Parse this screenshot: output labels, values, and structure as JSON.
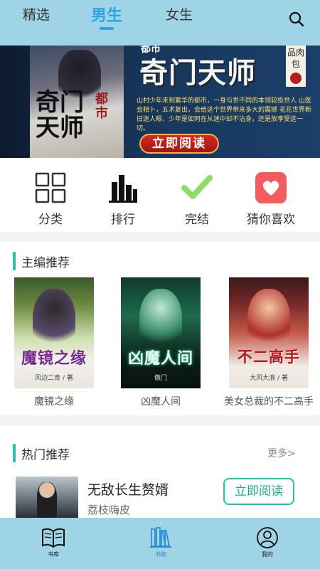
{
  "top_tabs": {
    "featured": "精选",
    "male": "男生",
    "female": "女生"
  },
  "banner": {
    "tag": "都市",
    "title": "奇门天师",
    "side_text": "品肉包",
    "cover_title": "奇门天师",
    "cover_series": "都市",
    "description": "山村少年来到繁华的都市，一身与世不同的本领较投世人 山医会相卜，五术复出，会给这个世界带来多大的震撼 花花世界新旧迷人眼，少年是如何在从迷中却不沾身，还是放享受这一切。",
    "button_label": "立即阅读"
  },
  "categories": [
    {
      "label": "分类",
      "icon": "grid-icon"
    },
    {
      "label": "排行",
      "icon": "bar-chart-icon"
    },
    {
      "label": "完结",
      "icon": "check-icon"
    },
    {
      "label": "猜你喜欢",
      "icon": "heart-icon"
    }
  ],
  "editor_picks": {
    "title": "主编推荐",
    "books": [
      {
        "name": "魔镜之缘",
        "cover_text": "魔镜之缘",
        "cover_author": "风边二青 / 著"
      },
      {
        "name": "凶魔人间",
        "cover_text": "凶魔人间",
        "cover_author": "傲门"
      },
      {
        "name": "美女总裁的不二高手",
        "cover_text": "不二高手",
        "cover_author": "大风大浪 / 著"
      }
    ]
  },
  "hot_picks": {
    "title": "热门推荐",
    "more": "更多>",
    "item": {
      "title": "无敌长生赘婿",
      "author": "荔枝嗨皮",
      "button": "立即阅读"
    }
  },
  "bottom_nav": {
    "items": [
      {
        "label": "书库",
        "icon": "open-book-icon",
        "active": false
      },
      {
        "label": "书架",
        "icon": "bookshelf-icon",
        "active": true
      },
      {
        "label": "我的",
        "icon": "user-icon",
        "active": false
      }
    ]
  },
  "colors": {
    "bar_bg": "#9fd3e6",
    "active_tab": "#2aa3e0",
    "accent": "#23c4a5",
    "check": "#8edb6a",
    "heart_bg": "#f25c5c"
  }
}
